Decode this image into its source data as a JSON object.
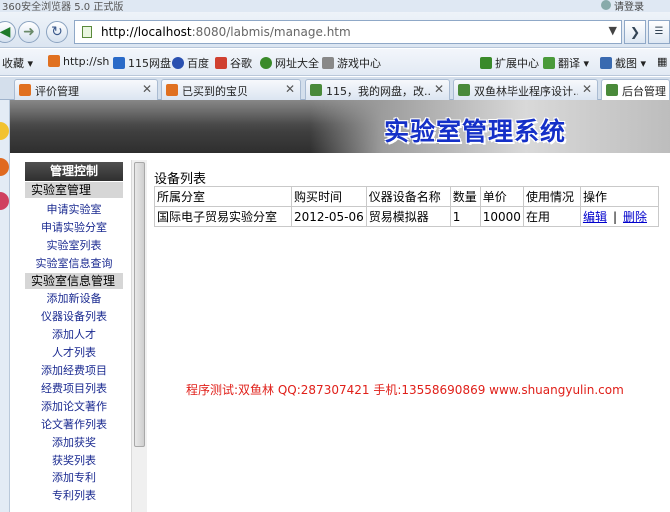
{
  "browser": {
    "title": "360安全浏览器 5.0 正式版",
    "login": "请登录",
    "url_host": "http://localhost",
    "url_rest": ":8080/labmis/manage.htm",
    "bookmarks": [
      "收藏",
      "http://sh",
      "115网盘",
      "百度",
      "谷歌",
      "网址大全",
      "游戏中心",
      "扩展中心",
      "翻译",
      "截图"
    ],
    "tabs": [
      {
        "title": "评价管理",
        "icon_color": "#e07020"
      },
      {
        "title": "已买到的宝贝",
        "icon_color": "#e07020"
      },
      {
        "title": "115，我的网盘，改...",
        "icon_color": "#4a8a3a"
      },
      {
        "title": "双鱼林毕业程序设计...",
        "icon_color": "#4a8a3a"
      },
      {
        "title": "后台管理",
        "icon_color": "#4a8a3a",
        "active": true
      }
    ]
  },
  "header": {
    "system_title": "实验室管理系统"
  },
  "sidebar": {
    "head": "管理控制",
    "sections": [
      {
        "title": "实验室管理",
        "items": [
          "申请实验室",
          "申请实验分室",
          "实验室列表",
          "实验室信息查询"
        ]
      },
      {
        "title": "实验室信息管理",
        "items": [
          "添加新设备",
          "仪器设备列表",
          "添加人才",
          "人才列表",
          "添加经费项目",
          "经费项目列表",
          "添加论文著作",
          "论文著作列表",
          "添加获奖",
          "获奖列表",
          "添加专利",
          "专利列表"
        ]
      }
    ]
  },
  "main": {
    "title": "设备列表",
    "columns": [
      "所属分室",
      "购买时间",
      "仪器设备名称",
      "数量",
      "单价",
      "使用情况",
      "操作"
    ],
    "rows": [
      {
        "room": "国际电子贸易实验分室",
        "date": "2012-05-06",
        "name": "贸易模拟器",
        "qty": "1",
        "price": "10000",
        "status": "在用",
        "edit": "编辑",
        "sep": "|",
        "delete": "删除"
      }
    ]
  },
  "footer": {
    "credit": "程序测试:双鱼林 QQ:287307421 手机:13558690869 www.shuangyulin.com"
  },
  "colors": {
    "link": "#0000cc",
    "menu_link": "#1a2a90",
    "credit": "#e0201a",
    "title_blue": "#1530c8"
  }
}
